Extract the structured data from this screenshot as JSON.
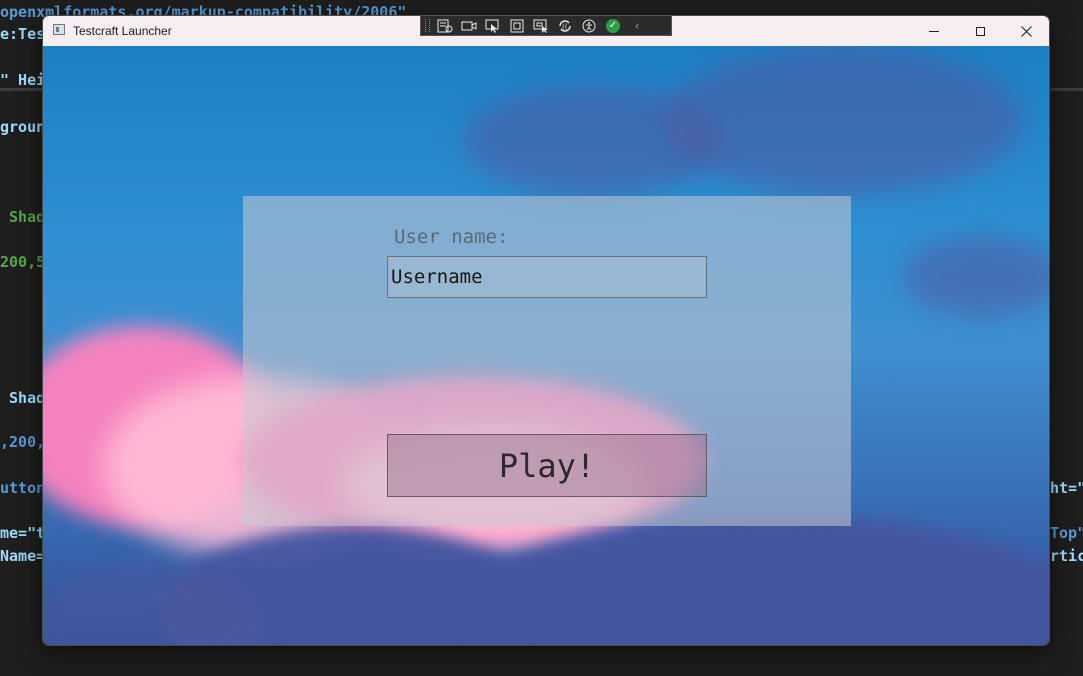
{
  "window": {
    "title": "Testcraft Launcher"
  },
  "login": {
    "user_label": "User name:",
    "username_value": "Username",
    "play_label": "Play!"
  },
  "debug_toolbar": {
    "icons": [
      "live-visual-tree-icon",
      "record-icon",
      "select-element-icon",
      "display-layout-adorners-icon",
      "track-focus-icon",
      "hot-reload-icon",
      "accessibility-icon",
      "xaml-binding-ok-icon",
      "collapse-icon"
    ]
  },
  "editor": {
    "line1": "openxmlformats.org/markup-compatibility/2006\"",
    "line2": "e:Tes",
    "line3": "\" Hei",
    "line4": "groun",
    "line5": " Shad",
    "line6": "200,5",
    "line7": " Shad",
    "line8": ",200,",
    "line9": "utton",
    "line10": "me=\"t",
    "line11": "Name=",
    "right1": "ht=\"",
    "right2": "Top\"",
    "right3": "rtic"
  },
  "colors": {
    "titlebar_bg": "#f7eef4",
    "panel_bg": "rgba(200,200,210,0.55)",
    "editor_bg": "#1e1e1e"
  }
}
